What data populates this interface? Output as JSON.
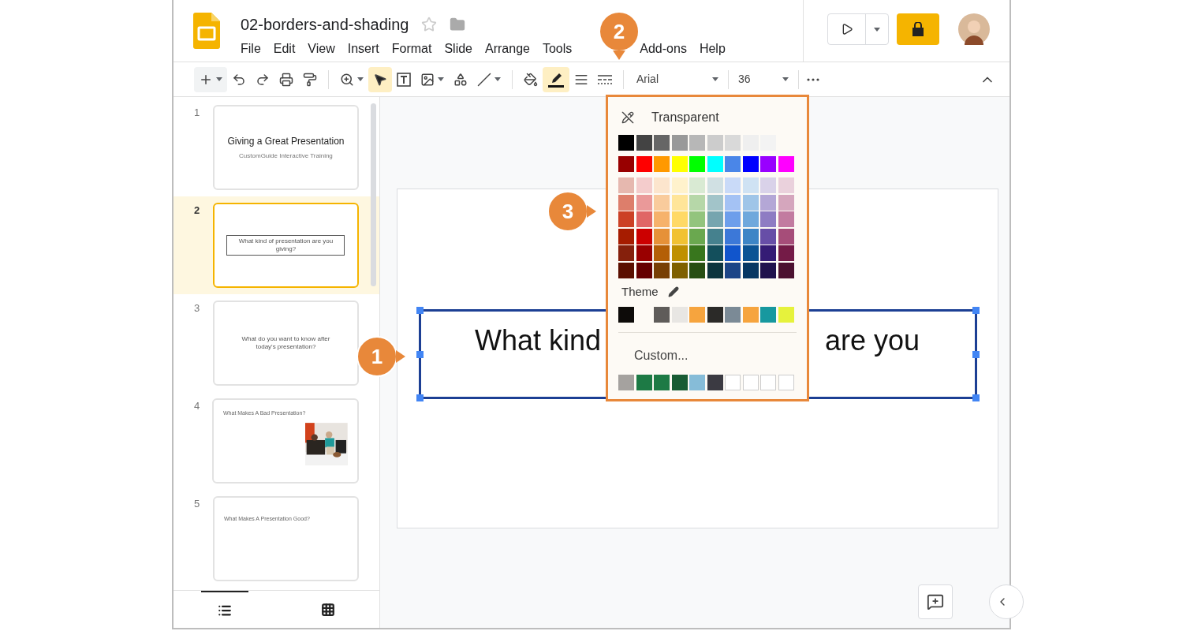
{
  "document": {
    "title": "02-borders-and-shading",
    "starred": false
  },
  "menu": [
    "File",
    "Edit",
    "View",
    "Insert",
    "Format",
    "Slide",
    "Arrange",
    "Tools",
    "Add-ons",
    "Help"
  ],
  "toolbar": {
    "font": "Arial",
    "font_size": "36",
    "border_color_active": true
  },
  "filmstrip": {
    "slides": [
      {
        "number": "1",
        "selected": false,
        "kind": "title",
        "title": "Giving a Great Presentation",
        "subtitle": "CustomGuide Interactive Training"
      },
      {
        "number": "2",
        "selected": true,
        "kind": "boxed",
        "title": "What kind of presentation are you giving?"
      },
      {
        "number": "3",
        "selected": false,
        "kind": "centered",
        "title": "What do you want to know after today's presentation?"
      },
      {
        "number": "4",
        "selected": false,
        "kind": "picture",
        "title": "What Makes A Bad Presentation?"
      },
      {
        "number": "5",
        "selected": false,
        "kind": "heading",
        "title": "What Makes A Presentation Good?"
      }
    ],
    "views": [
      {
        "kind": "list",
        "selected": true
      },
      {
        "kind": "grid",
        "selected": false
      }
    ]
  },
  "slide": {
    "text_left": "What kind",
    "text_right": "are you"
  },
  "color_picker": {
    "transparent": "Transparent",
    "theme_label": "Theme",
    "custom_label": "Custom...",
    "grey_row": [
      {
        "color": "#000000"
      },
      {
        "color": "#434343"
      },
      {
        "color": "#666666"
      },
      {
        "color": "#999999"
      },
      {
        "color": "#b7b7b7"
      },
      {
        "color": "#cccccc"
      },
      {
        "color": "#d9d9d9"
      },
      {
        "color": "#efefef"
      },
      {
        "color": "#f3f3f3"
      }
    ],
    "bright_row": [
      {
        "color": "#980000"
      },
      {
        "color": "#ff0000"
      },
      {
        "color": "#ff9900"
      },
      {
        "color": "#ffff00"
      },
      {
        "color": "#00ff00"
      },
      {
        "color": "#00ffff"
      },
      {
        "color": "#4a86e8"
      },
      {
        "color": "#0000ff"
      },
      {
        "color": "#9900ff"
      },
      {
        "color": "#ff00ff"
      }
    ],
    "shade_rows": [
      [
        {
          "color": "#e6b8af"
        },
        {
          "color": "#f4cccc"
        },
        {
          "color": "#fce5cd"
        },
        {
          "color": "#fff2cc"
        },
        {
          "color": "#d9ead3"
        },
        {
          "color": "#d0e0e3"
        },
        {
          "color": "#c9daf8"
        },
        {
          "color": "#cfe2f3"
        },
        {
          "color": "#d9d2e9"
        },
        {
          "color": "#ead1dc"
        }
      ],
      [
        {
          "color": "#dd7e6b"
        },
        {
          "color": "#ea9999"
        },
        {
          "color": "#f9cb9c"
        },
        {
          "color": "#ffe599"
        },
        {
          "color": "#b6d7a8"
        },
        {
          "color": "#a2c4c9"
        },
        {
          "color": "#a4c2f4"
        },
        {
          "color": "#9fc5e8"
        },
        {
          "color": "#b4a7d6"
        },
        {
          "color": "#d5a6bd"
        }
      ],
      [
        {
          "color": "#cc4125"
        },
        {
          "color": "#e06666"
        },
        {
          "color": "#f6b26b"
        },
        {
          "color": "#ffd966"
        },
        {
          "color": "#93c47d"
        },
        {
          "color": "#76a5af"
        },
        {
          "color": "#6d9eeb"
        },
        {
          "color": "#6fa8dc"
        },
        {
          "color": "#8e7cc3"
        },
        {
          "color": "#c27ba0"
        }
      ],
      [
        {
          "color": "#a61c00"
        },
        {
          "color": "#cc0000"
        },
        {
          "color": "#e69138"
        },
        {
          "color": "#f1c232"
        },
        {
          "color": "#6aa84f"
        },
        {
          "color": "#45818e"
        },
        {
          "color": "#3c78d8"
        },
        {
          "color": "#3d85c6"
        },
        {
          "color": "#674ea7"
        },
        {
          "color": "#a64d79"
        }
      ],
      [
        {
          "color": "#85200c"
        },
        {
          "color": "#990000"
        },
        {
          "color": "#b45f06"
        },
        {
          "color": "#bf9000"
        },
        {
          "color": "#38761d"
        },
        {
          "color": "#134f5c"
        },
        {
          "color": "#1155cc"
        },
        {
          "color": "#0b5394"
        },
        {
          "color": "#351c75"
        },
        {
          "color": "#741b47"
        }
      ],
      [
        {
          "color": "#5b0f00"
        },
        {
          "color": "#660000"
        },
        {
          "color": "#783f04"
        },
        {
          "color": "#7f6000"
        },
        {
          "color": "#274e13"
        },
        {
          "color": "#0c343d"
        },
        {
          "color": "#1c4587"
        },
        {
          "color": "#073763"
        },
        {
          "color": "#20124d"
        },
        {
          "color": "#4c1130"
        }
      ]
    ],
    "theme_row": [
      {
        "kind": "color",
        "color": "#0d0b09"
      },
      {
        "kind": "gap"
      },
      {
        "kind": "color",
        "color": "#5f5c5a"
      },
      {
        "kind": "color",
        "color": "#e8e6e3"
      },
      {
        "kind": "color",
        "color": "#f6a43e"
      },
      {
        "kind": "color",
        "color": "#2b2a28"
      },
      {
        "kind": "color",
        "color": "#7b8a96"
      },
      {
        "kind": "color",
        "color": "#f6a43e"
      },
      {
        "kind": "color",
        "color": "#17989f"
      },
      {
        "kind": "color",
        "color": "#e6f23c"
      }
    ],
    "custom_row": [
      {
        "kind": "color",
        "color": "#a5a29f"
      },
      {
        "kind": "color",
        "color": "#1d7a45"
      },
      {
        "kind": "color",
        "color": "#1d7a45"
      },
      {
        "kind": "color",
        "color": "#185c34"
      },
      {
        "kind": "color",
        "color": "#86bcd8"
      },
      {
        "kind": "color",
        "color": "#3b3a42"
      },
      {
        "kind": "empty"
      },
      {
        "kind": "empty"
      },
      {
        "kind": "empty"
      },
      {
        "kind": "empty"
      }
    ]
  },
  "callouts": [
    "1",
    "2",
    "3"
  ]
}
